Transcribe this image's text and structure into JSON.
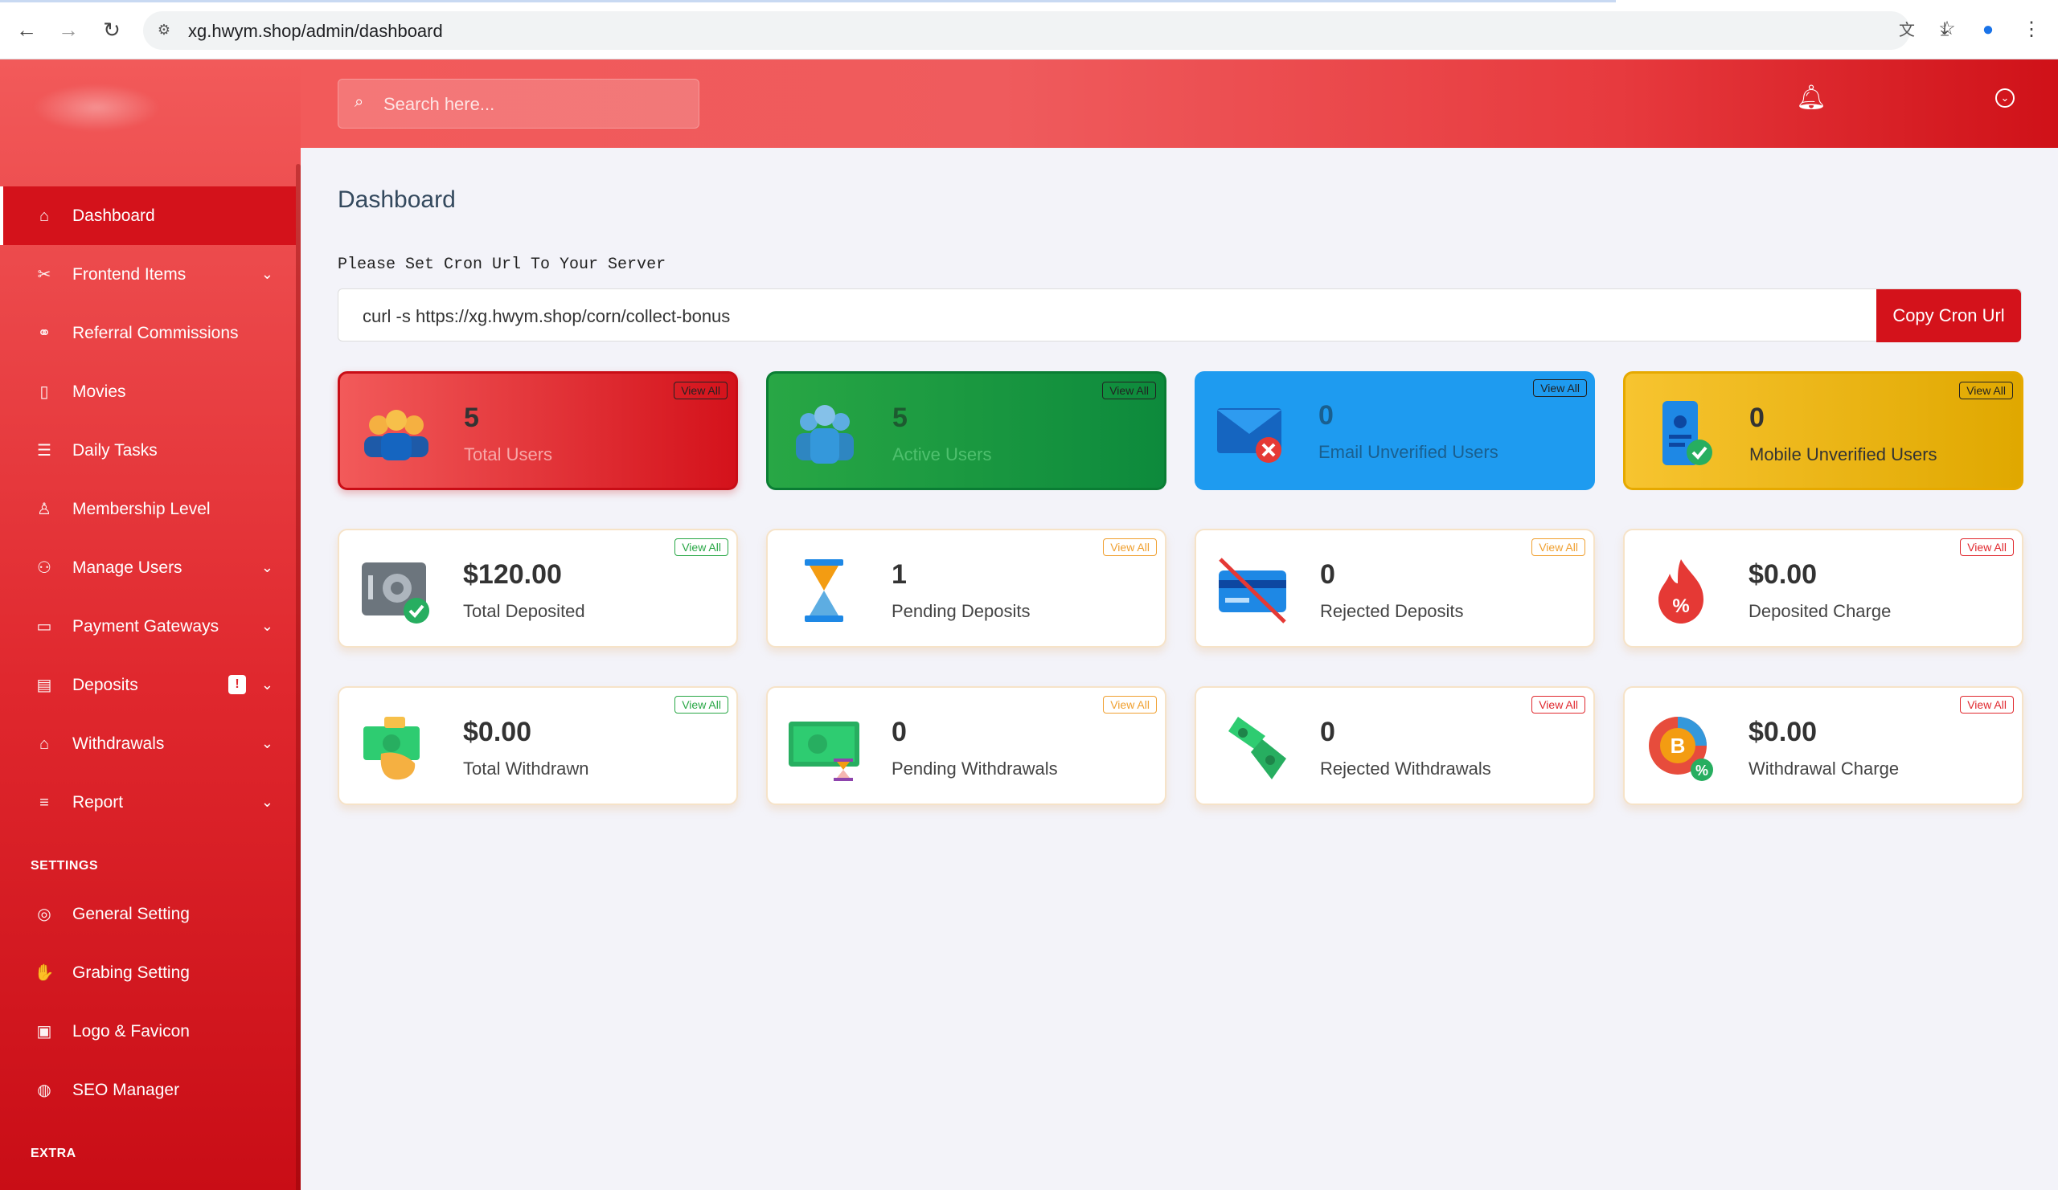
{
  "browser": {
    "url": "xg.hwym.shop/admin/dashboard"
  },
  "sidebar": {
    "items": [
      {
        "label": "Dashboard",
        "icon": "home-icon",
        "active": true
      },
      {
        "label": "Frontend Items",
        "icon": "tools-icon",
        "caret": true
      },
      {
        "label": "Referral Commissions",
        "icon": "link-icon"
      },
      {
        "label": "Movies",
        "icon": "film-icon"
      },
      {
        "label": "Daily Tasks",
        "icon": "list-icon"
      },
      {
        "label": "Membership Level",
        "icon": "badge-icon"
      },
      {
        "label": "Manage Users",
        "icon": "users-icon",
        "caret": true
      },
      {
        "label": "Payment Gateways",
        "icon": "card-icon",
        "caret": true
      },
      {
        "label": "Deposits",
        "icon": "receipt-icon",
        "caret": true,
        "alert": "!"
      },
      {
        "label": "Withdrawals",
        "icon": "bank-icon",
        "caret": true
      },
      {
        "label": "Report",
        "icon": "report-icon",
        "caret": true
      }
    ],
    "settings_title": "SETTINGS",
    "settings": [
      {
        "label": "General Setting",
        "icon": "life-ring-icon"
      },
      {
        "label": "Grabing Setting",
        "icon": "hand-coin-icon"
      },
      {
        "label": "Logo & Favicon",
        "icon": "image-icon"
      },
      {
        "label": "SEO Manager",
        "icon": "globe-icon"
      }
    ],
    "extra_title": "EXTRA"
  },
  "topbar": {
    "search_placeholder": "Search here..."
  },
  "main": {
    "title": "Dashboard",
    "cron_label": "Please Set Cron Url To Your Server",
    "cron_value": "curl -s https://xg.hwym.shop/corn/collect-bonus",
    "cron_button": "Copy Cron Url"
  },
  "cards": [
    {
      "value": "5",
      "label": "Total Users",
      "view": "View All"
    },
    {
      "value": "5",
      "label": "Active Users",
      "view": "View All"
    },
    {
      "value": "0",
      "label": "Email Unverified Users",
      "view": "View All"
    },
    {
      "value": "0",
      "label": "Mobile Unverified Users",
      "view": "View All"
    },
    {
      "value": "$120.00",
      "label": "Total Deposited",
      "view": "View All"
    },
    {
      "value": "1",
      "label": "Pending Deposits",
      "view": "View All"
    },
    {
      "value": "0",
      "label": "Rejected Deposits",
      "view": "View All"
    },
    {
      "value": "$0.00",
      "label": "Deposited Charge",
      "view": "View All"
    },
    {
      "value": "$0.00",
      "label": "Total Withdrawn",
      "view": "View All"
    },
    {
      "value": "0",
      "label": "Pending Withdrawals",
      "view": "View All"
    },
    {
      "value": "0",
      "label": "Rejected Withdrawals",
      "view": "View All"
    },
    {
      "value": "$0.00",
      "label": "Withdrawal Charge",
      "view": "View All"
    }
  ]
}
